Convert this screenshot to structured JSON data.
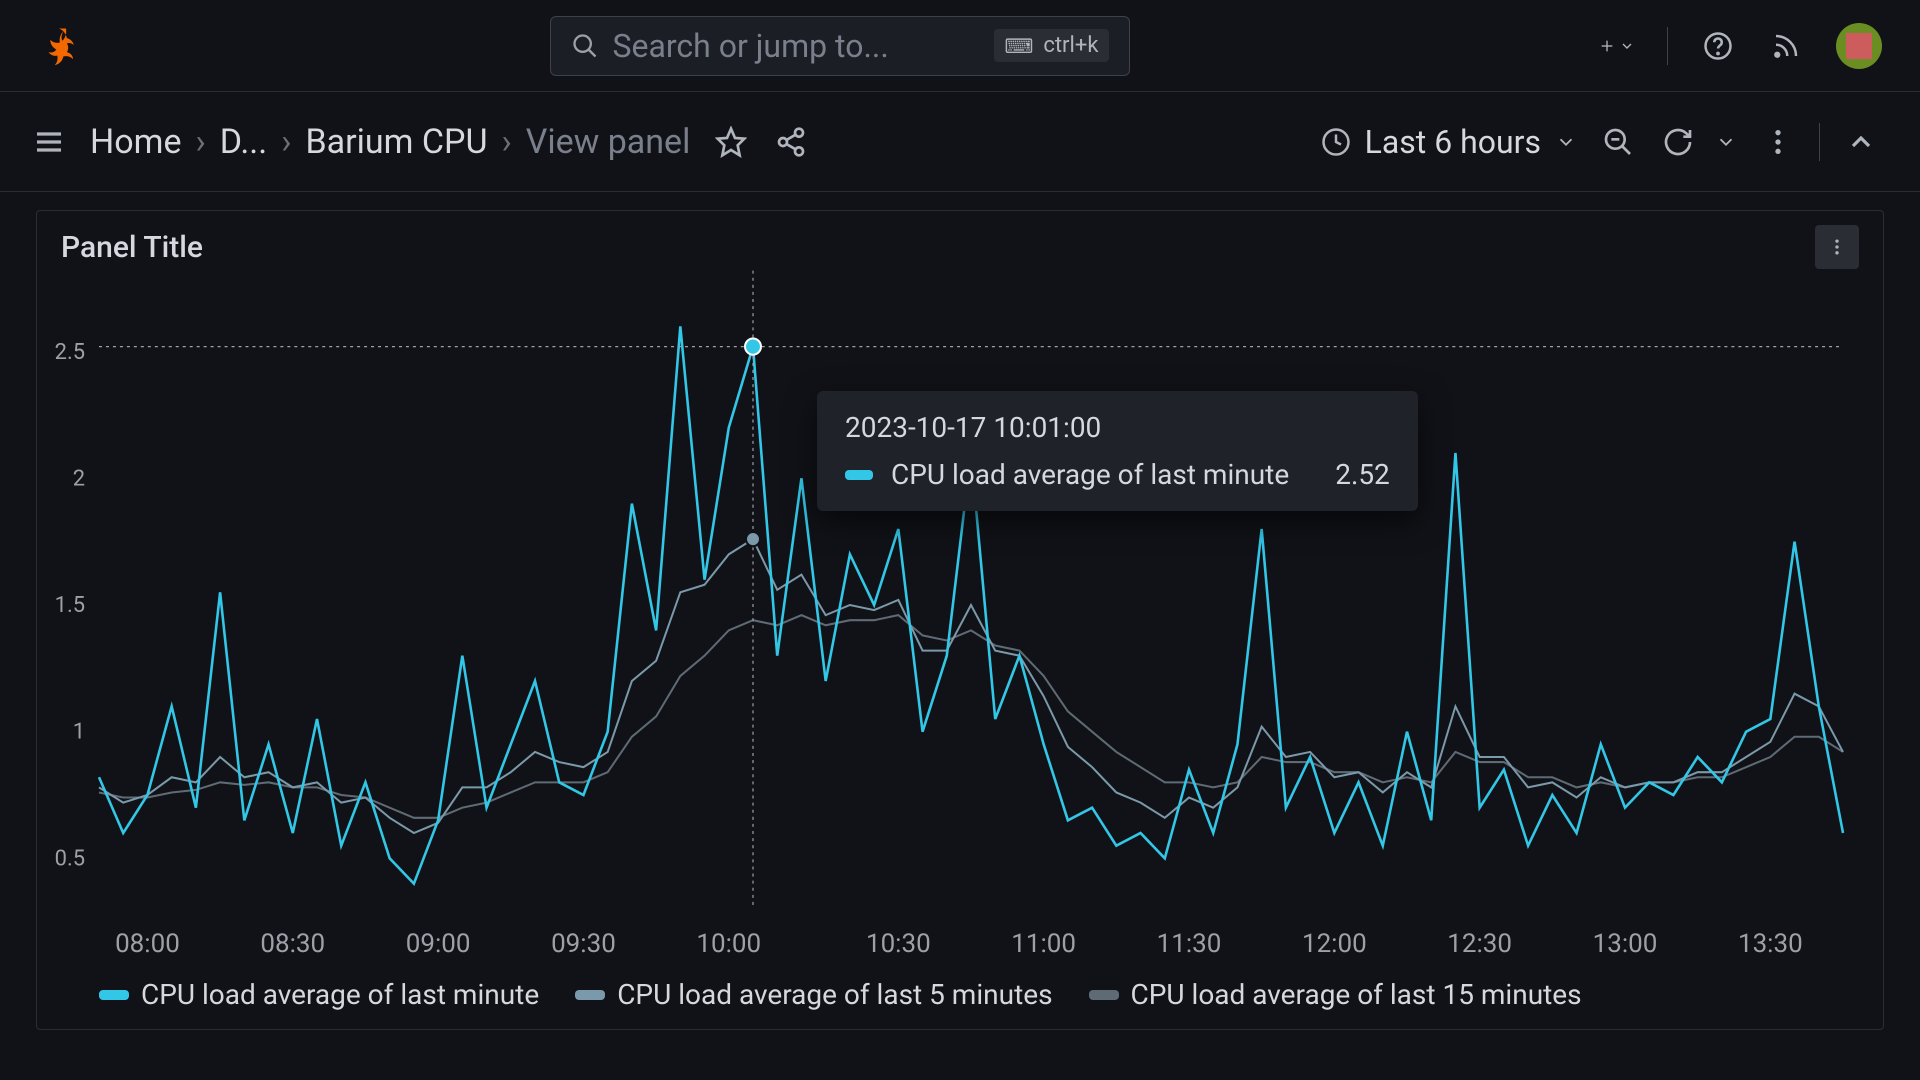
{
  "search": {
    "placeholder": "Search or jump to...",
    "shortcut": "ctrl+k"
  },
  "breadcrumb": {
    "home": "Home",
    "dashboards": "D...",
    "dashboard": "Barium CPU",
    "view": "View panel"
  },
  "timepicker": {
    "label": "Last 6 hours"
  },
  "panel": {
    "title": "Panel Title"
  },
  "tooltip": {
    "time": "2023-10-17 10:01:00",
    "series": "CPU load average of last minute",
    "value": "2.52"
  },
  "legend": {
    "s1": "CPU load average of last minute",
    "s2": "CPU load average of last 5 minutes",
    "s3": "CPU load average of last 15 minutes"
  },
  "chart_data": {
    "type": "line",
    "title": "Panel Title",
    "xlabel": "",
    "ylabel": "",
    "ylim": [
      0.3,
      2.7
    ],
    "x_ticks": [
      "08:00",
      "08:30",
      "09:00",
      "09:30",
      "10:00",
      "10:30",
      "11:00",
      "11:30",
      "12:00",
      "12:30",
      "13:00",
      "13:30"
    ],
    "y_ticks": [
      0.5,
      1,
      1.5,
      2,
      2.5
    ],
    "hover": {
      "x": "10:01",
      "series_index": 0,
      "value": 2.52
    },
    "x": [
      "07:50",
      "07:55",
      "08:00",
      "08:05",
      "08:10",
      "08:15",
      "08:20",
      "08:25",
      "08:30",
      "08:35",
      "08:40",
      "08:45",
      "08:50",
      "08:55",
      "09:00",
      "09:05",
      "09:10",
      "09:15",
      "09:20",
      "09:25",
      "09:30",
      "09:35",
      "09:40",
      "09:45",
      "09:50",
      "09:55",
      "10:00",
      "10:01",
      "10:05",
      "10:10",
      "10:15",
      "10:20",
      "10:25",
      "10:30",
      "10:35",
      "10:40",
      "10:45",
      "10:50",
      "10:55",
      "11:00",
      "11:05",
      "11:10",
      "11:15",
      "11:20",
      "11:25",
      "11:30",
      "11:35",
      "11:40",
      "11:45",
      "11:50",
      "11:55",
      "12:00",
      "12:05",
      "12:10",
      "12:15",
      "12:20",
      "12:25",
      "12:30",
      "12:35",
      "12:40",
      "12:45",
      "12:50",
      "12:55",
      "13:00",
      "13:05",
      "13:10",
      "13:15",
      "13:20",
      "13:25",
      "13:30",
      "13:35",
      "13:40",
      "13:45"
    ],
    "series": [
      {
        "name": "CPU load average of last minute",
        "color": "#32c7e6",
        "values": [
          0.82,
          0.6,
          0.75,
          1.1,
          0.7,
          1.55,
          0.65,
          0.95,
          0.6,
          1.05,
          0.55,
          0.8,
          0.5,
          0.4,
          0.65,
          1.3,
          0.7,
          0.95,
          1.2,
          0.8,
          0.75,
          1.0,
          1.9,
          1.4,
          2.6,
          1.6,
          2.2,
          2.52,
          1.3,
          2.0,
          1.2,
          1.7,
          1.5,
          1.8,
          1.0,
          1.3,
          2.1,
          1.05,
          1.3,
          0.95,
          0.65,
          0.7,
          0.55,
          0.6,
          0.5,
          0.85,
          0.6,
          0.95,
          1.8,
          0.7,
          0.9,
          0.6,
          0.8,
          0.55,
          1.0,
          0.65,
          2.1,
          0.7,
          0.85,
          0.55,
          0.75,
          0.6,
          0.95,
          0.7,
          0.8,
          0.75,
          0.9,
          0.8,
          1.0,
          1.05,
          1.75,
          1.1,
          0.6
        ]
      },
      {
        "name": "CPU load average of last 5 minutes",
        "color": "#7a99aa",
        "values": [
          0.78,
          0.72,
          0.75,
          0.82,
          0.8,
          0.9,
          0.82,
          0.84,
          0.78,
          0.8,
          0.72,
          0.74,
          0.66,
          0.6,
          0.64,
          0.78,
          0.78,
          0.84,
          0.92,
          0.88,
          0.86,
          0.92,
          1.2,
          1.28,
          1.55,
          1.58,
          1.7,
          1.76,
          1.56,
          1.62,
          1.46,
          1.5,
          1.48,
          1.52,
          1.32,
          1.32,
          1.5,
          1.32,
          1.3,
          1.14,
          0.94,
          0.86,
          0.76,
          0.72,
          0.66,
          0.74,
          0.7,
          0.78,
          1.02,
          0.9,
          0.92,
          0.82,
          0.84,
          0.76,
          0.84,
          0.78,
          1.1,
          0.9,
          0.9,
          0.78,
          0.8,
          0.74,
          0.82,
          0.78,
          0.8,
          0.8,
          0.84,
          0.84,
          0.9,
          0.96,
          1.15,
          1.1,
          0.92
        ]
      },
      {
        "name": "CPU load average of last 15 minutes",
        "color": "#5f6b74",
        "values": [
          0.76,
          0.74,
          0.74,
          0.76,
          0.77,
          0.8,
          0.79,
          0.8,
          0.78,
          0.78,
          0.75,
          0.74,
          0.7,
          0.66,
          0.66,
          0.7,
          0.72,
          0.76,
          0.8,
          0.8,
          0.8,
          0.84,
          0.98,
          1.06,
          1.22,
          1.3,
          1.4,
          1.44,
          1.42,
          1.46,
          1.42,
          1.44,
          1.44,
          1.46,
          1.38,
          1.36,
          1.4,
          1.34,
          1.32,
          1.22,
          1.08,
          1.0,
          0.92,
          0.86,
          0.8,
          0.8,
          0.78,
          0.8,
          0.9,
          0.88,
          0.88,
          0.84,
          0.84,
          0.8,
          0.82,
          0.8,
          0.92,
          0.88,
          0.88,
          0.82,
          0.82,
          0.78,
          0.8,
          0.78,
          0.8,
          0.8,
          0.82,
          0.82,
          0.86,
          0.9,
          0.98,
          0.98,
          0.92
        ]
      }
    ]
  }
}
